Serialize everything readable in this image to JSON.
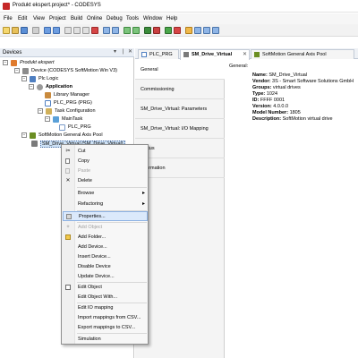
{
  "window": {
    "title": "Produkt ekspert.project* - CODESYS"
  },
  "menubar": [
    "File",
    "Edit",
    "View",
    "Project",
    "Build",
    "Online",
    "Debug",
    "Tools",
    "Window",
    "Help"
  ],
  "devices": {
    "header": "Devices",
    "tree": [
      {
        "label": "Produkt ekspert",
        "icon": "project-icon"
      },
      {
        "label": "Device (CODESYS SoftMotion Win V3)",
        "icon": "device-icon"
      },
      {
        "label": "Plc Logic",
        "icon": "plc-logic-icon"
      },
      {
        "label": "Application",
        "icon": "application-icon"
      },
      {
        "label": "Library Manager",
        "icon": "library-icon"
      },
      {
        "label": "PLC_PRG (PRG)",
        "icon": "pou-icon"
      },
      {
        "label": "Task Configuration",
        "icon": "task-config-icon"
      },
      {
        "label": "MainTask",
        "icon": "task-icon"
      },
      {
        "label": "PLC_PRG",
        "icon": "pou-call-icon"
      },
      {
        "label": "SoftMotion General Axis Pool",
        "icon": "axis-pool-icon"
      },
      {
        "label": "SM_Drive_Virtual (SM_Drive_Virtual)",
        "icon": "drive-icon"
      }
    ]
  },
  "tabs": [
    {
      "label": "PLC_PRG"
    },
    {
      "label": "SM_Drive_Virtual"
    },
    {
      "label": "SoftMotion General Axis Pool"
    }
  ],
  "side_tabs": [
    "General",
    "Commissioning",
    "SM_Drive_Virtual: Parameters",
    "SM_Drive_Virtual: I/O Mapping",
    "Status",
    "Information"
  ],
  "general": {
    "heading": "General:",
    "props": [
      {
        "key": "Name:",
        "value": "SM_Drive_Virtual"
      },
      {
        "key": "Vendor:",
        "value": "3S - Smart Software Solutions GmbH"
      },
      {
        "key": "Groups:",
        "value": "virtual drives"
      },
      {
        "key": "Type:",
        "value": "1024"
      },
      {
        "key": "ID:",
        "value": "FFFF 0001"
      },
      {
        "key": "Version:",
        "value": "4.0.0.0"
      },
      {
        "key": "Model Number:",
        "value": "1805"
      },
      {
        "key": "Description:",
        "value": "SoftMotion virtual drive"
      }
    ]
  },
  "context_menu": {
    "items": [
      {
        "label": "Cut",
        "icon": "cut-icon",
        "enabled": true
      },
      {
        "label": "Copy",
        "icon": "copy-icon",
        "enabled": true
      },
      {
        "label": "Paste",
        "icon": "paste-icon",
        "enabled": false
      },
      {
        "label": "Delete",
        "icon": "delete-icon",
        "enabled": true
      },
      {
        "label": "Browse",
        "icon": "",
        "enabled": true,
        "submenu": true
      },
      {
        "label": "Refactoring",
        "icon": "",
        "enabled": true,
        "submenu": true
      },
      {
        "label": "Properties...",
        "icon": "properties-icon",
        "enabled": true,
        "hover": true
      },
      {
        "label": "Add Object",
        "icon": "add-object-icon",
        "enabled": false
      },
      {
        "label": "Add Folder...",
        "icon": "folder-icon",
        "enabled": true
      },
      {
        "label": "Add Device...",
        "icon": "",
        "enabled": true
      },
      {
        "label": "Insert Device...",
        "icon": "",
        "enabled": true
      },
      {
        "label": "Disable Device",
        "icon": "",
        "enabled": true
      },
      {
        "label": "Update Device...",
        "icon": "",
        "enabled": true
      },
      {
        "label": "Edit Object",
        "icon": "edit-object-icon",
        "enabled": true
      },
      {
        "label": "Edit Object With...",
        "icon": "",
        "enabled": true
      },
      {
        "label": "Edit IO mapping",
        "icon": "",
        "enabled": true
      },
      {
        "label": "Import mappings from CSV...",
        "icon": "",
        "enabled": true
      },
      {
        "label": "Export mappings to CSV...",
        "icon": "",
        "enabled": true
      },
      {
        "label": "Simulation",
        "icon": "",
        "enabled": true
      }
    ]
  },
  "colors": {
    "accent": "#c62828",
    "selection": "#cfe3f7",
    "menu_hover": "#dbe9fb",
    "disabled_text": "#a0a0a0"
  }
}
